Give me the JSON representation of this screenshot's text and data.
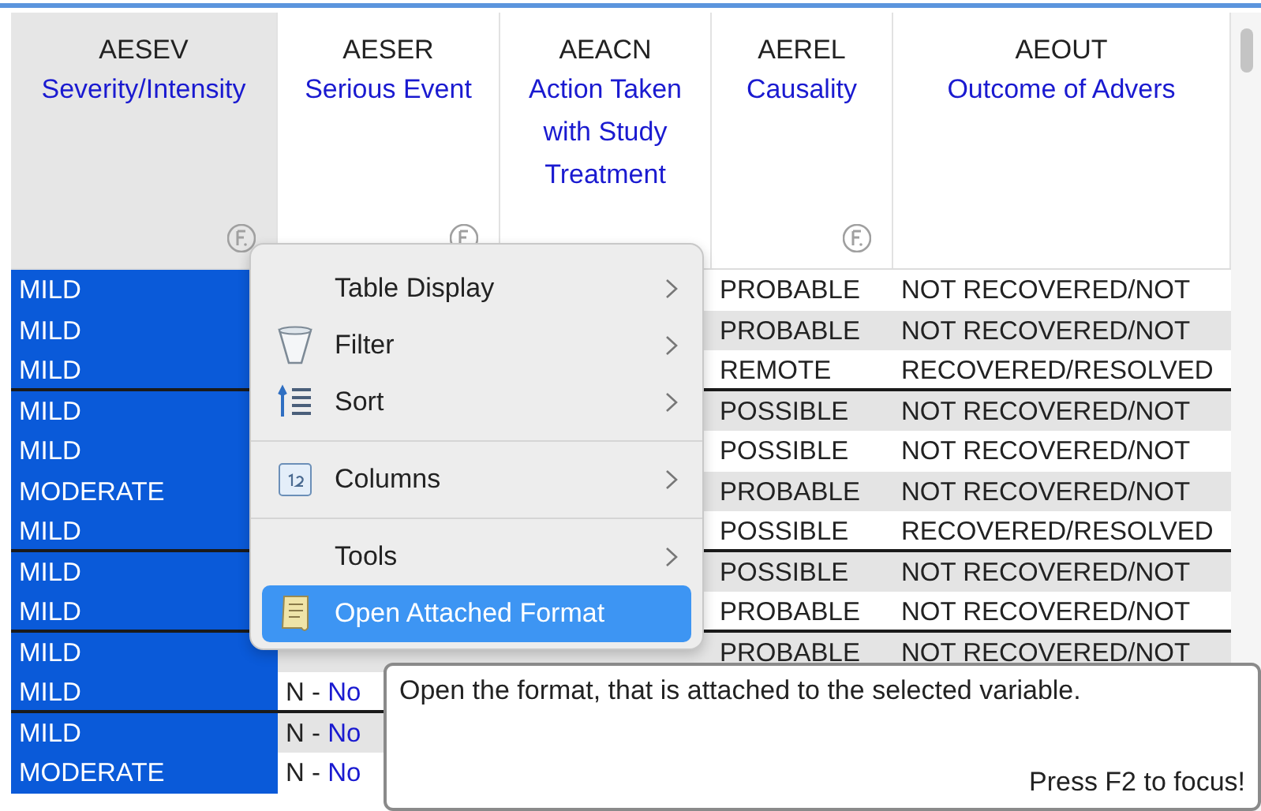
{
  "columns": [
    {
      "name": "AESEV",
      "label": "Severity/Intensity",
      "selected": true,
      "has_format": true
    },
    {
      "name": "AESER",
      "label": "Serious Event",
      "selected": false,
      "has_format": true
    },
    {
      "name": "AEACN",
      "label": "Action Taken with Study Treatment",
      "selected": false,
      "has_format": false
    },
    {
      "name": "AEREL",
      "label": "Causality",
      "selected": false,
      "has_format": true
    },
    {
      "name": "AEOUT",
      "label": "Outcome of Advers",
      "selected": false,
      "has_format": false
    }
  ],
  "rows": [
    {
      "shaded": false,
      "group_end": false,
      "aesev": "MILD",
      "aerel": "PROBABLE",
      "aeout": "NOT RECOVERED/NOT"
    },
    {
      "shaded": true,
      "group_end": false,
      "aesev": "MILD",
      "aerel": "PROBABLE",
      "aeout": "NOT RECOVERED/NOT"
    },
    {
      "shaded": false,
      "group_end": true,
      "aesev": "MILD",
      "aerel": "REMOTE",
      "aeout": "RECOVERED/RESOLVED"
    },
    {
      "shaded": true,
      "group_end": false,
      "aesev": "MILD",
      "aerel": "POSSIBLE",
      "aeout": "NOT RECOVERED/NOT"
    },
    {
      "shaded": false,
      "group_end": false,
      "aesev": "MILD",
      "aerel": "POSSIBLE",
      "aeout": "NOT RECOVERED/NOT"
    },
    {
      "shaded": true,
      "group_end": false,
      "aesev": "MODERATE",
      "aerel": "PROBABLE",
      "aeout": "NOT RECOVERED/NOT"
    },
    {
      "shaded": false,
      "group_end": true,
      "aesev": "MILD",
      "aerel": "POSSIBLE",
      "aeout": "RECOVERED/RESOLVED"
    },
    {
      "shaded": true,
      "group_end": false,
      "aesev": "MILD",
      "aerel": "POSSIBLE",
      "aeout": "NOT RECOVERED/NOT"
    },
    {
      "shaded": false,
      "group_end": true,
      "aesev": "MILD",
      "aerel": "PROBABLE",
      "aeout": "NOT RECOVERED/NOT"
    },
    {
      "shaded": true,
      "group_end": false,
      "aesev": "MILD",
      "aerel": "PROBABLE",
      "aeout": "NOT RECOVERED/NOT"
    },
    {
      "shaded": false,
      "group_end": true,
      "aesev": "MILD",
      "aeser": {
        "code": "N -",
        "decode": "No"
      }
    },
    {
      "shaded": true,
      "group_end": false,
      "aesev": "MILD",
      "aeser": {
        "code": "N -",
        "decode": "No"
      }
    },
    {
      "shaded": false,
      "group_end": false,
      "aesev": "MODERATE",
      "aeser": {
        "code": "N -",
        "decode": "No"
      }
    }
  ],
  "context_menu": {
    "items": [
      {
        "kind": "item",
        "label": "Table Display",
        "submenu": true,
        "selected": false
      },
      {
        "kind": "item",
        "label": "Filter",
        "submenu": true,
        "selected": false
      },
      {
        "kind": "item",
        "label": "Sort",
        "submenu": true,
        "selected": false
      },
      {
        "kind": "separator"
      },
      {
        "kind": "item",
        "label": "Columns",
        "submenu": true,
        "selected": false
      },
      {
        "kind": "separator"
      },
      {
        "kind": "item",
        "label": "Tools",
        "submenu": true,
        "selected": false
      },
      {
        "kind": "item",
        "label": "Open Attached Format",
        "submenu": false,
        "selected": true
      }
    ]
  },
  "tooltip": {
    "text": "Open the format, that is attached to the selected variable.",
    "hint": "Press F2 to focus!"
  }
}
